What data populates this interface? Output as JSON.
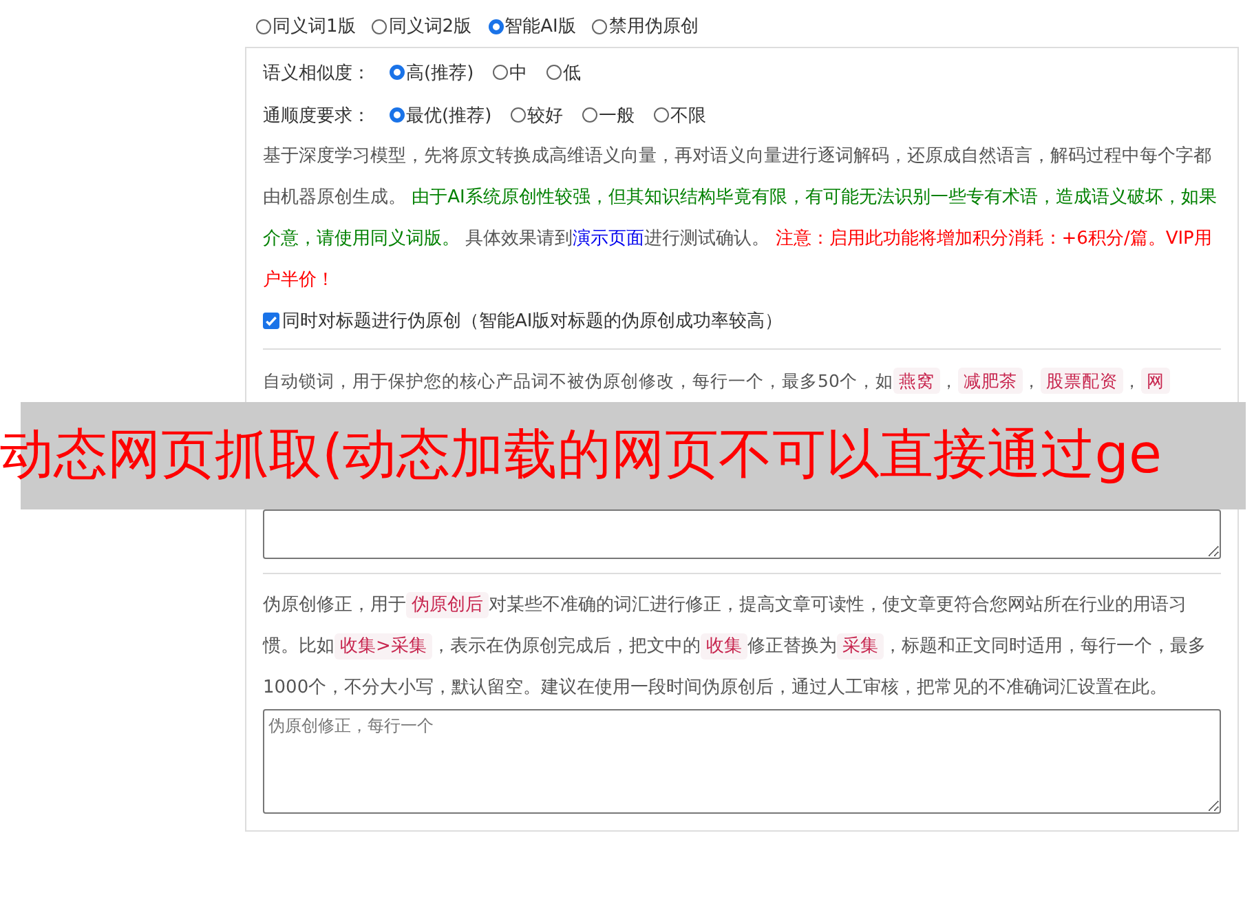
{
  "version_options": [
    {
      "label": "同义词1版",
      "selected": false
    },
    {
      "label": "同义词2版",
      "selected": false
    },
    {
      "label": "智能AI版",
      "selected": true
    },
    {
      "label": "禁用伪原创",
      "selected": false
    }
  ],
  "similarity": {
    "label": "语义相似度：",
    "options": [
      {
        "label": "高(推荐)",
        "selected": true
      },
      {
        "label": "中",
        "selected": false
      },
      {
        "label": "低",
        "selected": false
      }
    ]
  },
  "fluency": {
    "label": "通顺度要求：",
    "options": [
      {
        "label": "最优(推荐)",
        "selected": true
      },
      {
        "label": "较好",
        "selected": false
      },
      {
        "label": "一般",
        "selected": false
      },
      {
        "label": "不限",
        "selected": false
      }
    ]
  },
  "description": [
    {
      "kind": "plain",
      "text": "基于深度学习模型，先将原文转换成高维语义向量，再对语义向量进行逐词解码，还原成自然语言，解码过程中每个字都由机器原创生成。 "
    },
    {
      "kind": "info",
      "text": "由于AI系统原创性较强，但其知识结构毕竟有限，有可能无法识别一些专有术语，造成语义破坏，如果介意，请使用同义词版。"
    },
    {
      "kind": "plain",
      "text": " 具体效果请到"
    },
    {
      "kind": "link",
      "text": "演示页面"
    },
    {
      "kind": "plain",
      "text": "进行测试确认。 "
    },
    {
      "kind": "warning",
      "text": "注意：启用此功能将增加积分消耗：+6积分/篇。VIP用户半价！"
    }
  ],
  "title_option": {
    "label": "同时对标题进行伪原创（智能AI版对标题的伪原创成功率较高）",
    "checked": true
  },
  "lock_words": {
    "description": [
      {
        "kind": "plain",
        "text": "自动锁词，用于保护您的核心产品词不被伪原创修改，每行一个，最多50个，如"
      },
      {
        "kind": "tag",
        "text": "燕窝"
      },
      {
        "kind": "plain",
        "text": "，"
      },
      {
        "kind": "tag",
        "text": "减肥茶"
      },
      {
        "kind": "plain",
        "text": "，"
      },
      {
        "kind": "tag",
        "text": "股票配资"
      },
      {
        "kind": "plain",
        "text": "，"
      },
      {
        "kind": "tag",
        "text": "网"
      }
    ]
  },
  "corrections": {
    "description": [
      {
        "kind": "plain",
        "text": "伪原创修正，用于"
      },
      {
        "kind": "tag",
        "text": "伪原创后"
      },
      {
        "kind": "plain",
        "text": "对某些不准确的词汇进行修正，提高文章可读性，使文章更符合您网站所在行业的用语习惯。比如"
      },
      {
        "kind": "tag",
        "text": "收集>采集"
      },
      {
        "kind": "plain",
        "text": "，表示在伪原创完成后，把文中的"
      },
      {
        "kind": "tag",
        "text": "收集"
      },
      {
        "kind": "plain",
        "text": "修正替换为"
      },
      {
        "kind": "tag",
        "text": "采集"
      },
      {
        "kind": "plain",
        "text": "，标题和正文同时适用，每行一个，最多1000个，不分大小写，默认留空。建议在使用一段时间伪原创后，通过人工审核，把常见的不准确词汇设置在此。"
      }
    ],
    "placeholder": "伪原创修正，每行一个"
  },
  "banner": {
    "text": "动态网页抓取(动态加载的网页不可以直接通过ge"
  }
}
